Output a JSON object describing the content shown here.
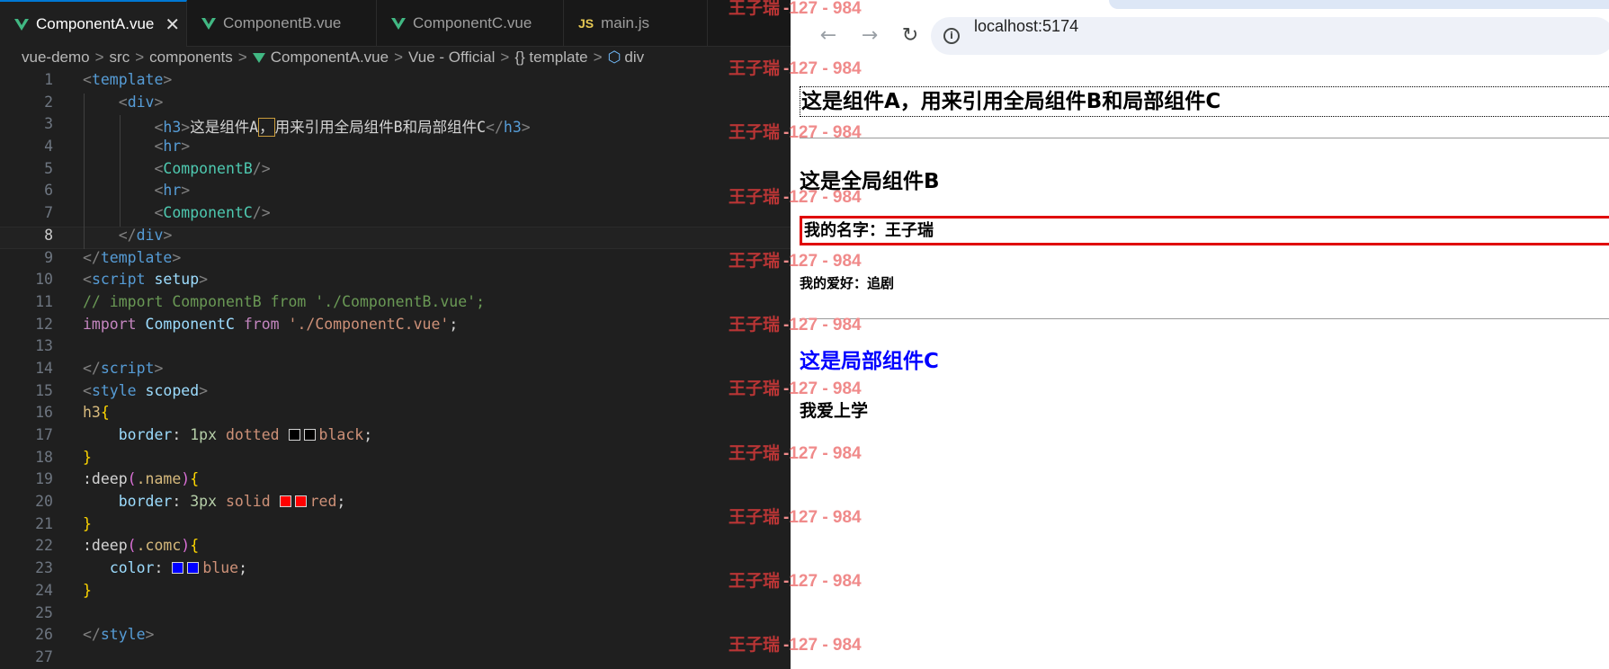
{
  "editor": {
    "tabs": [
      {
        "label": "ComponentA.vue",
        "icon": "vue-icon",
        "active": true
      },
      {
        "label": "ComponentB.vue",
        "icon": "vue-icon",
        "active": false
      },
      {
        "label": "ComponentC.vue",
        "icon": "vue-icon",
        "active": false
      },
      {
        "label": "main.js",
        "icon": "js-icon",
        "active": false
      }
    ],
    "close_glyph": "✕",
    "js_badge": "JS",
    "breadcrumb": [
      "vue-demo",
      "src",
      "components",
      "ComponentA.vue",
      "Vue - Official",
      "{} template",
      "div"
    ],
    "breadcrumb_sep": ">",
    "current_line": 8
  },
  "browser": {
    "url": "localhost:5174",
    "nav": {
      "back": "←",
      "forward": "→",
      "reload": "↻"
    },
    "page": {
      "h3_a": "这是组件A，用来引用全局组件B和局部组件C",
      "h_b": "这是全局组件B",
      "name_line": "我的名字：王子瑞",
      "hobby_line": "我的爱好：追剧",
      "h_c": "这是局部组件C",
      "study_line": "我爱上学"
    }
  },
  "watermark": {
    "name": "王子瑞",
    "code": "-127 - 984"
  },
  "colors": {
    "accent": "#0078d4",
    "vue_green": "#41b883",
    "red_border": "#e00000",
    "blue_text": "#0000ff"
  }
}
